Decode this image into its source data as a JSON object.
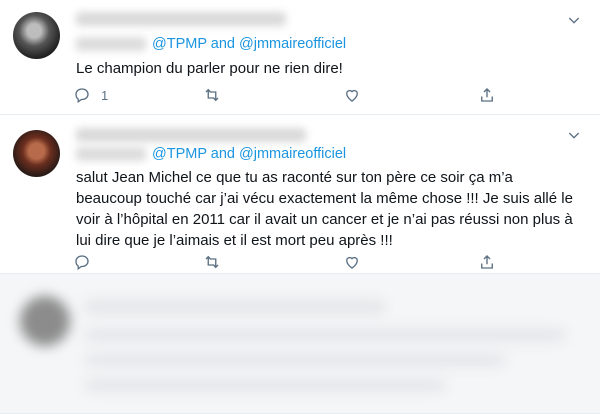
{
  "colors": {
    "accent": "#1b95e0",
    "muted": "#5b7083",
    "text": "#0f1419",
    "border": "#e6ecf0"
  },
  "tweets": [
    {
      "reply_to_prefix": "",
      "mention1": "@TPMP",
      "conjunction": "and",
      "mention2": "@jmmaireofficiel",
      "text": "Le champion du parler pour ne rien dire!",
      "reply_count": "1",
      "icons": [
        "chevron-down-icon",
        "reply-icon",
        "retweet-icon",
        "like-icon",
        "share-icon"
      ]
    },
    {
      "mention1": "@TPMP",
      "conjunction": "and",
      "mention2": "@jmmaireofficiel",
      "text": "salut Jean Michel ce que tu as raconté sur ton père ce soir ça m’a beaucoup touché car j’ai vécu exactement la même chose !!! Je suis allé le voir à l’hôpital en 2011 car il avait un cancer et je n’ai pas réussi non plus à lui dire que je l’aimais et il est mort peu après !!!",
      "reply_count": "",
      "icons": [
        "chevron-down-icon",
        "reply-icon",
        "retweet-icon",
        "like-icon",
        "share-icon"
      ]
    }
  ]
}
